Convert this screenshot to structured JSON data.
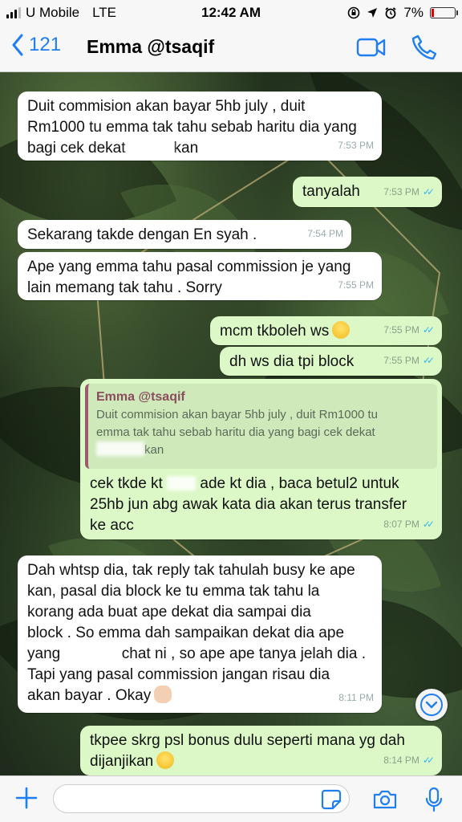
{
  "status_bar": {
    "carrier": "U Mobile",
    "network": "LTE",
    "time": "12:42 AM",
    "battery": "7%"
  },
  "nav": {
    "back_count": "121",
    "contact_name": "Emma @tsaqif"
  },
  "messages": [
    {
      "dir": "in",
      "parts": [
        "Duit commision akan bayar 5hb july , duit\nRm1000 tu emma tak tahu sebab haritu dia yang\nbagi cek dekat",
        "kan"
      ],
      "time": "7:53 PM"
    },
    {
      "dir": "out",
      "text": "tanyalah",
      "time": "7:53 PM"
    },
    {
      "dir": "in",
      "text": "Sekarang takde dengan En syah .",
      "time": "7:54 PM"
    },
    {
      "dir": "in",
      "text": "Ape yang emma tahu pasal commission je yang\nlain memang tak tahu . Sorry",
      "time": "7:55 PM"
    },
    {
      "dir": "out",
      "text": "mcm tkboleh ws",
      "time": "7:55 PM"
    },
    {
      "dir": "out",
      "text": "dh ws dia tpi block",
      "time": "7:55 PM"
    },
    {
      "dir": "out",
      "quote_name": "Emma @tsaqif",
      "quote_text": "Duit commision akan bayar 5hb july , duit Rm1000 tu\nemma tak tahu sebab haritu dia yang bagi cek dekat",
      "quote_tail": "kan",
      "parts": [
        "cek tkde kt",
        "ade kt dia , baca betul2 untuk\n25hb jun abg awak kata dia akan terus transfer\nke acc"
      ],
      "time": "8:07 PM"
    },
    {
      "dir": "in",
      "parts": [
        "Dah whtsp dia, tak reply tak tahulah busy ke ape\nkan, pasal dia block ke tu emma tak tahu la\nkorang ada buat ape dekat dia sampai dia\nblock . So emma dah sampaikan dekat dia ape\nyang",
        "chat ni , so ape ape tanya jelah dia .\nTapi yang pasal commission jangan risau dia\nakan bayar . Okay"
      ],
      "time": "8:11 PM"
    },
    {
      "dir": "out",
      "text": "tkpee skrg psl bonus dulu seperti mana yg dah\ndijanjikan",
      "time": "8:14 PM"
    }
  ],
  "icons": {
    "back": "chevron-left-icon",
    "video": "video-camera-icon",
    "call": "phone-icon",
    "scroll": "chevron-down-icon",
    "attach": "plus-icon",
    "sticker": "sticker-icon",
    "camera": "camera-icon",
    "mic": "microphone-icon"
  },
  "colors": {
    "accent": "#1f7ef0",
    "outgoing_bubble": "#dcf8c6",
    "incoming_bubble": "#ffffff",
    "read_ticks": "#34b7f1",
    "quote_bar": "#9a5b6c"
  }
}
